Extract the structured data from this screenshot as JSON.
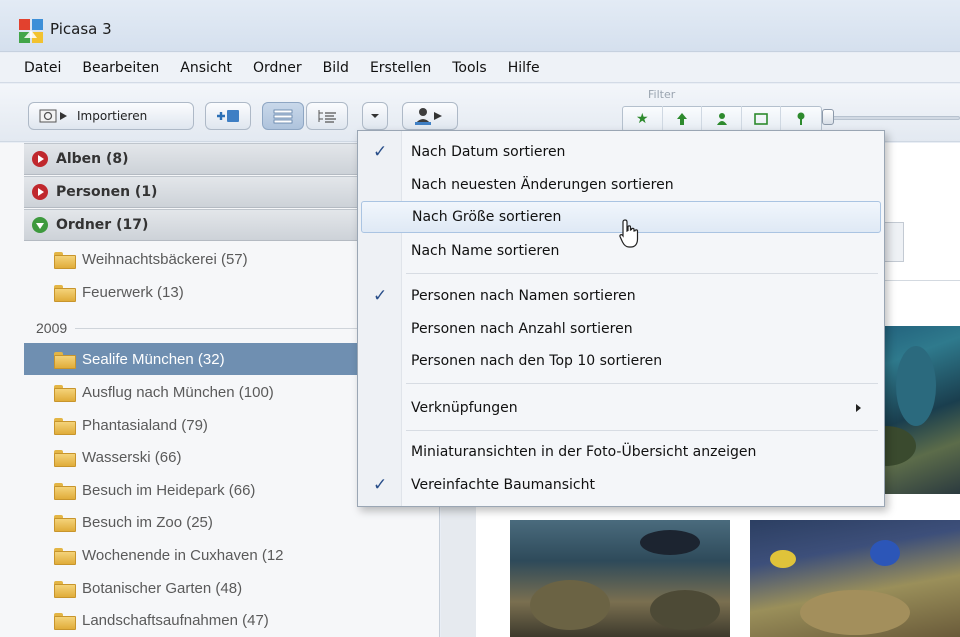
{
  "window": {
    "title": "Picasa 3"
  },
  "menubar": {
    "items": [
      "Datei",
      "Bearbeiten",
      "Ansicht",
      "Ordner",
      "Bild",
      "Erstellen",
      "Tools",
      "Hilfe"
    ]
  },
  "toolbar": {
    "import_label": "Importieren",
    "filter_label": "Filter",
    "filter_icons": [
      "star-icon",
      "upload-icon",
      "person-icon",
      "movie-icon",
      "location-icon"
    ]
  },
  "left_panel": {
    "groups": [
      {
        "label": "Alben (8)",
        "state": "collapsed"
      },
      {
        "label": "Personen (1)",
        "state": "collapsed"
      },
      {
        "label": "Ordner (17)",
        "state": "expanded"
      }
    ],
    "folders_top": [
      "Weihnachtsbäckerei (57)",
      "Feuerwerk (13)"
    ],
    "year": "2009",
    "folders_year": [
      {
        "label": "Sealife München (32)",
        "selected": true
      },
      {
        "label": "Ausflug nach München (100)",
        "selected": false
      },
      {
        "label": "Phantasialand (79)",
        "selected": false
      },
      {
        "label": "Wasserski (66)",
        "selected": false
      },
      {
        "label": "Besuch im Heidepark (66)",
        "selected": false
      },
      {
        "label": "Besuch im Zoo (25)",
        "selected": false
      },
      {
        "label": "Wochenende in Cuxhaven (12",
        "selected": false
      },
      {
        "label": "Botanischer Garten (48)",
        "selected": false
      },
      {
        "label": "Landschaftsaufnahmen (47)",
        "selected": false
      }
    ]
  },
  "dropdown": {
    "items": [
      {
        "label": "Nach Datum sortieren",
        "checked": true,
        "highlighted": false
      },
      {
        "label": "Nach neuesten Änderungen sortieren",
        "checked": false,
        "highlighted": false
      },
      {
        "label": "Nach Größe sortieren",
        "checked": false,
        "highlighted": true
      },
      {
        "label": "Nach Name sortieren",
        "checked": false,
        "highlighted": false
      },
      {
        "label": "Personen nach Namen sortieren",
        "checked": true,
        "highlighted": false
      },
      {
        "label": "Personen nach Anzahl sortieren",
        "checked": false,
        "highlighted": false
      },
      {
        "label": "Personen nach den Top 10 sortieren",
        "checked": false,
        "highlighted": false
      },
      {
        "label": "Verknüpfungen",
        "checked": false,
        "highlighted": false,
        "submenu": true
      },
      {
        "label": "Miniaturansichten in der Foto-Übersicht anzeigen",
        "checked": false,
        "highlighted": false
      },
      {
        "label": "Vereinfachte Baumansicht",
        "checked": true,
        "highlighted": false
      }
    ],
    "check_glyph": "✓"
  },
  "colors": {
    "selection": "#6f8fb1",
    "accent_red": "#c0282d",
    "accent_green": "#3e9a3e",
    "check": "#2a4f8a"
  }
}
